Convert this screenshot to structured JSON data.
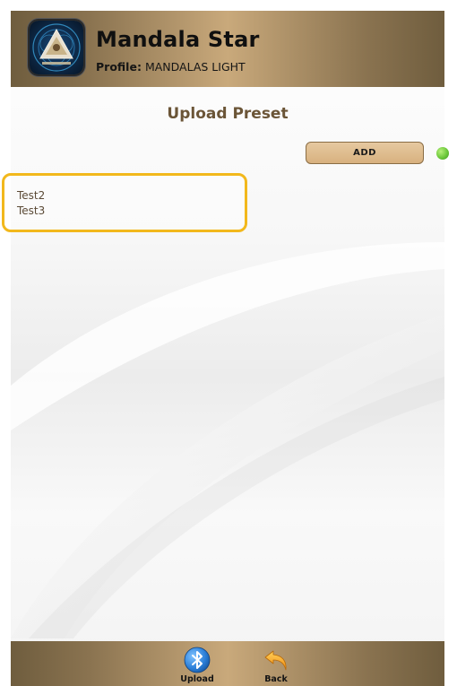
{
  "header": {
    "app_title": "Mandala Star",
    "profile_label": "Profile:",
    "profile_value": "MANDALAS LIGHT",
    "app_icon": "mandala-logo-icon"
  },
  "page": {
    "title": "Upload Preset"
  },
  "actions": {
    "add_label": "ADD",
    "status_color": "#6cc83b"
  },
  "presets": {
    "items": [
      "Test2",
      "Test3"
    ]
  },
  "toolbar": {
    "upload_label": "Upload",
    "upload_icon": "bluetooth-icon",
    "back_label": "Back",
    "back_icon": "back-arrow-icon"
  },
  "colors": {
    "header_gradient_mid": "#c9a97b",
    "header_gradient_edge": "#6f5d3e",
    "list_border": "#f2b81c",
    "title_text": "#6b5537"
  }
}
